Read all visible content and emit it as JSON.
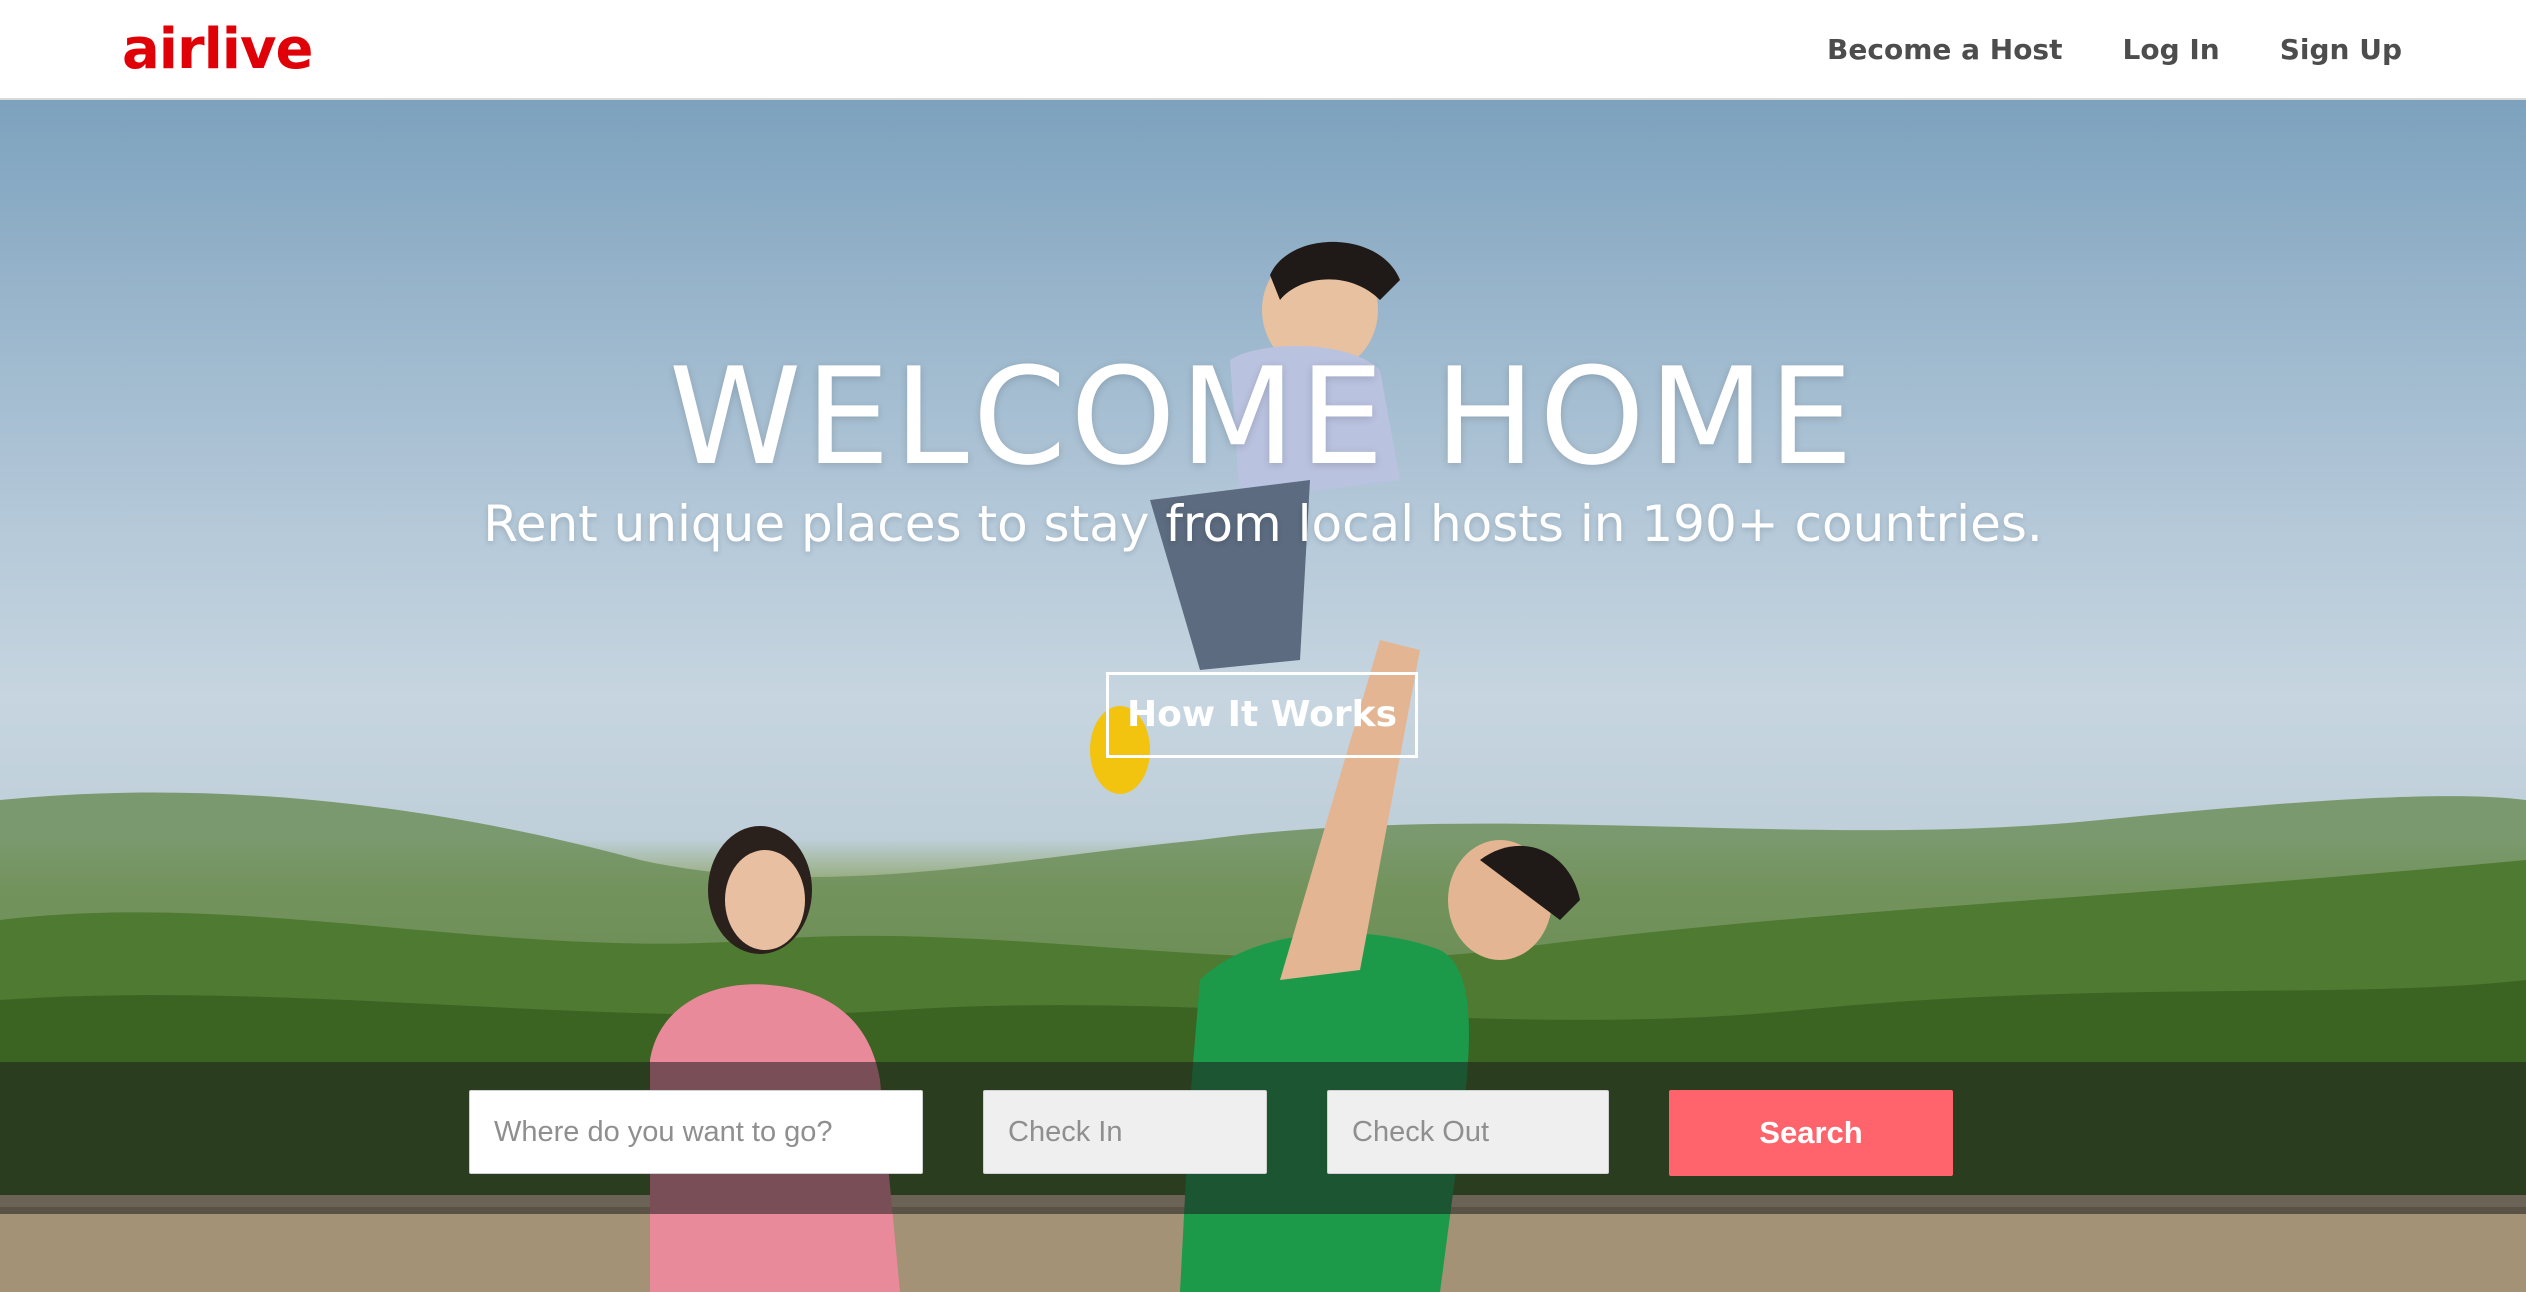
{
  "brand": {
    "logo_text": "airlive",
    "logo_color": "#e00007"
  },
  "nav": {
    "items": [
      {
        "label": "Become a Host"
      },
      {
        "label": "Log In"
      },
      {
        "label": "Sign Up"
      }
    ]
  },
  "hero": {
    "title": "WELCOME HOME",
    "subtitle": "Rent unique places to stay from local hosts in 190+ countries.",
    "cta_label": "How It Works"
  },
  "search": {
    "where_placeholder": "Where do you want to go?",
    "check_in_placeholder": "Check In",
    "check_out_placeholder": "Check Out",
    "button_label": "Search",
    "button_color": "#ff636b"
  }
}
